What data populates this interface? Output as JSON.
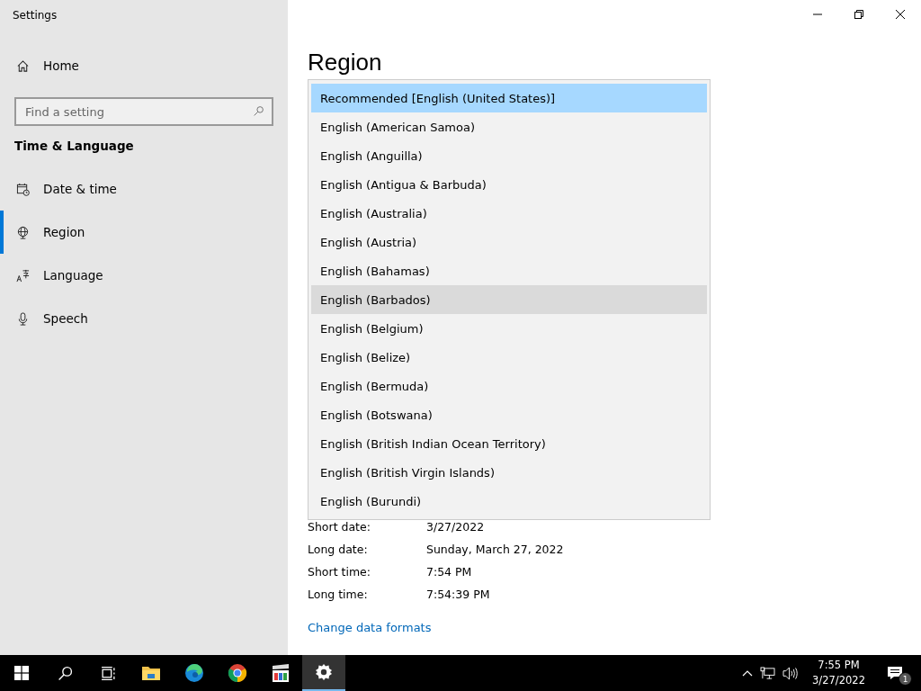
{
  "window": {
    "title": "Settings"
  },
  "sidebar": {
    "home": "Home",
    "search": {
      "placeholder": "Find a setting"
    },
    "section": "Time & Language",
    "items": [
      {
        "label": "Date & time",
        "selected": false
      },
      {
        "label": "Region",
        "selected": true
      },
      {
        "label": "Language",
        "selected": false
      },
      {
        "label": "Speech",
        "selected": false
      }
    ]
  },
  "page": {
    "title": "Region",
    "dropdown": {
      "options": [
        {
          "label": "Recommended [English (United States)]",
          "selected": true,
          "hovered": false
        },
        {
          "label": "English (American Samoa)",
          "selected": false,
          "hovered": false
        },
        {
          "label": "English (Anguilla)",
          "selected": false,
          "hovered": false
        },
        {
          "label": "English (Antigua & Barbuda)",
          "selected": false,
          "hovered": false
        },
        {
          "label": "English (Australia)",
          "selected": false,
          "hovered": false
        },
        {
          "label": "English (Austria)",
          "selected": false,
          "hovered": false
        },
        {
          "label": "English (Bahamas)",
          "selected": false,
          "hovered": false
        },
        {
          "label": "English (Barbados)",
          "selected": false,
          "hovered": true
        },
        {
          "label": "English (Belgium)",
          "selected": false,
          "hovered": false
        },
        {
          "label": "English (Belize)",
          "selected": false,
          "hovered": false
        },
        {
          "label": "English (Bermuda)",
          "selected": false,
          "hovered": false
        },
        {
          "label": "English (Botswana)",
          "selected": false,
          "hovered": false
        },
        {
          "label": "English (British Indian Ocean Territory)",
          "selected": false,
          "hovered": false
        },
        {
          "label": "English (British Virgin Islands)",
          "selected": false,
          "hovered": false
        },
        {
          "label": "English (Burundi)",
          "selected": false,
          "hovered": false
        }
      ]
    },
    "formats": [
      {
        "label": "Short date:",
        "value": "3/27/2022"
      },
      {
        "label": "Long date:",
        "value": "Sunday, March 27, 2022"
      },
      {
        "label": "Short time:",
        "value": "7:54 PM"
      },
      {
        "label": "Long time:",
        "value": "7:54:39 PM"
      }
    ],
    "link": "Change data formats"
  },
  "taskbar": {
    "apps": [
      {
        "kind": "start",
        "active": false
      },
      {
        "kind": "search",
        "active": false
      },
      {
        "kind": "taskview",
        "active": false
      },
      {
        "kind": "explorer",
        "active": false
      },
      {
        "kind": "edge",
        "active": false
      },
      {
        "kind": "chrome",
        "active": false
      },
      {
        "kind": "player",
        "active": false
      },
      {
        "kind": "settings",
        "active": true
      }
    ],
    "time": "7:55 PM",
    "date": "3/27/2022",
    "notifications": "1"
  }
}
